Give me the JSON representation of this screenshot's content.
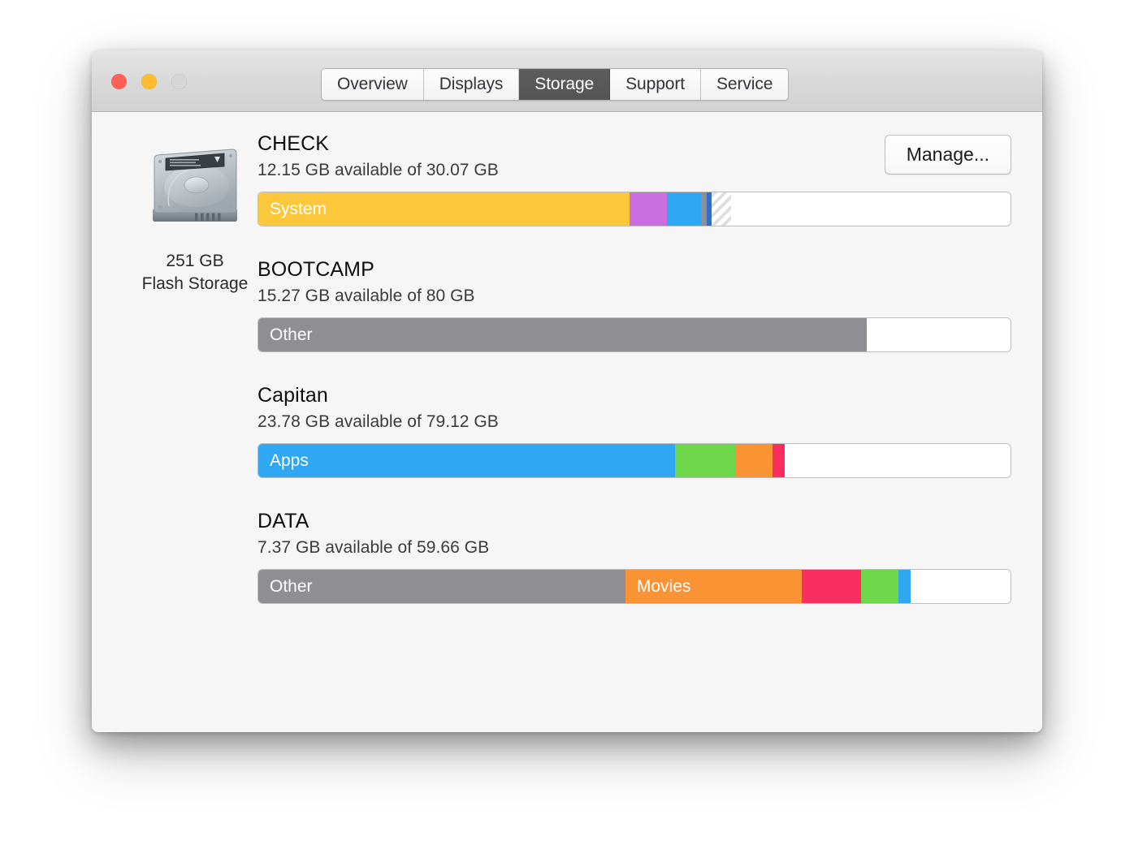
{
  "window": {
    "traffic_lights": [
      {
        "name": "close",
        "color": "#ff6058"
      },
      {
        "name": "minimize",
        "color": "#ffbd2e"
      },
      {
        "name": "zoom",
        "color": "#d6d6d6"
      }
    ],
    "tabs": [
      {
        "label": "Overview",
        "selected": false
      },
      {
        "label": "Displays",
        "selected": false
      },
      {
        "label": "Storage",
        "selected": true
      },
      {
        "label": "Support",
        "selected": false
      },
      {
        "label": "Service",
        "selected": false
      }
    ]
  },
  "drive": {
    "icon": "hard-disk-icon",
    "capacity": "251 GB",
    "type": "Flash Storage"
  },
  "actions": {
    "manage_label": "Manage..."
  },
  "colors": {
    "system": "#fbc83c",
    "photos": "#c86ee0",
    "apps": "#2fa7f2",
    "other": "#8e8e93",
    "documents": "#2c6fd1",
    "movies": "#fb9233",
    "audio": "#6ed84a",
    "mail": "#fb2e62",
    "purgeable": "#dedede",
    "free": "#ffffff",
    "tab_selected_bg": "#585858",
    "window_bg": "#f6f6f6"
  },
  "volumes": [
    {
      "name": "CHECK",
      "subtitle": "12.15 GB available of 30.07 GB",
      "available": "12.15 GB",
      "total": "30.07 GB",
      "segments": [
        {
          "label": "System",
          "color": "#fbc83c",
          "pct": 49.3,
          "kind": "solid"
        },
        {
          "label": "",
          "color": "#c86ee0",
          "pct": 5.0,
          "kind": "solid"
        },
        {
          "label": "",
          "color": "#2fa7f2",
          "pct": 4.6,
          "kind": "solid"
        },
        {
          "label": "",
          "color": "#8e8e93",
          "pct": 0.7,
          "kind": "solid"
        },
        {
          "label": "",
          "color": "#2c6fd1",
          "pct": 0.7,
          "kind": "solid"
        },
        {
          "label": "",
          "color": "#dedede",
          "pct": 2.6,
          "kind": "hatched"
        },
        {
          "label": "",
          "color": "#ffffff",
          "pct": 37.1,
          "kind": "empty"
        }
      ]
    },
    {
      "name": "BOOTCAMP",
      "subtitle": "15.27 GB available of 80 GB",
      "available": "15.27 GB",
      "total": "80 GB",
      "segments": [
        {
          "label": "Other",
          "color": "#8e8e93",
          "pct": 80.9,
          "kind": "solid"
        },
        {
          "label": "",
          "color": "#ffffff",
          "pct": 19.1,
          "kind": "empty"
        }
      ]
    },
    {
      "name": "Capitan",
      "subtitle": "23.78 GB available of 79.12 GB",
      "available": "23.78 GB",
      "total": "79.12 GB",
      "segments": [
        {
          "label": "Apps",
          "color": "#2fa7f2",
          "pct": 55.4,
          "kind": "solid"
        },
        {
          "label": "",
          "color": "#6ed84a",
          "pct": 8.0,
          "kind": "solid"
        },
        {
          "label": "",
          "color": "#fb9233",
          "pct": 5.0,
          "kind": "solid"
        },
        {
          "label": "",
          "color": "#fb2e62",
          "pct": 1.6,
          "kind": "solid"
        },
        {
          "label": "",
          "color": "#ffffff",
          "pct": 30.0,
          "kind": "empty"
        }
      ]
    },
    {
      "name": "DATA",
      "subtitle": "7.37 GB available of 59.66 GB",
      "available": "7.37 GB",
      "total": "59.66 GB",
      "segments": [
        {
          "label": "Other",
          "color": "#8e8e93",
          "pct": 48.8,
          "kind": "solid"
        },
        {
          "label": "Movies",
          "color": "#fb9233",
          "pct": 23.5,
          "kind": "solid"
        },
        {
          "label": "",
          "color": "#fb2e62",
          "pct": 7.8,
          "kind": "solid"
        },
        {
          "label": "",
          "color": "#6ed84a",
          "pct": 5.0,
          "kind": "solid"
        },
        {
          "label": "",
          "color": "#2fa7f2",
          "pct": 1.6,
          "kind": "solid"
        },
        {
          "label": "",
          "color": "#ffffff",
          "pct": 13.3,
          "kind": "empty"
        }
      ]
    }
  ]
}
